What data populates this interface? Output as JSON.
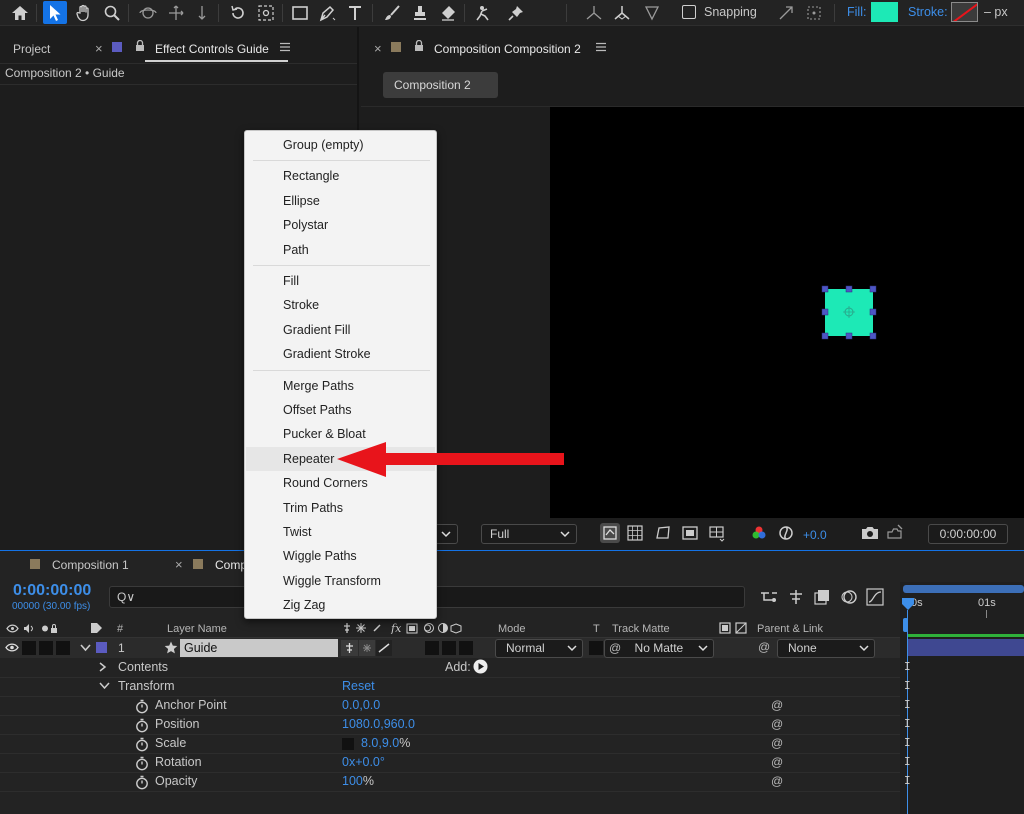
{
  "toolbar": {
    "snapping_label": "Snapping",
    "fill_label": "Fill:",
    "fill_color": "#1de9b6",
    "stroke_label": "Stroke:",
    "stroke_unit": "– px"
  },
  "left_panel": {
    "tab_project": "Project",
    "tab_effect_controls": "Effect Controls Guide",
    "subtitle": "Composition 2 • Guide"
  },
  "comp_panel": {
    "tab_title": "Composition Composition 2",
    "breadcrumb": "Composition 2",
    "shape_color": "#1de9b6"
  },
  "context_menu": {
    "groups": [
      [
        "Group (empty)"
      ],
      [
        "Rectangle",
        "Ellipse",
        "Polystar",
        "Path"
      ],
      [
        "Fill",
        "Stroke",
        "Gradient Fill",
        "Gradient Stroke"
      ],
      [
        "Merge Paths",
        "Offset Paths",
        "Pucker & Bloat",
        "Repeater",
        "Round Corners",
        "Trim Paths",
        "Twist",
        "Wiggle Paths",
        "Wiggle Transform",
        "Zig Zag"
      ]
    ],
    "highlighted": "Repeater",
    "arrow_color": "#e8141b"
  },
  "viewer_controls": {
    "resolution": "Full",
    "exposure": "+0.0",
    "timecode": "0:00:00:00"
  },
  "timeline": {
    "tab_comp1": "Composition 1",
    "tab_comp2_partial": "Comp",
    "current_time": "0:00:00:00",
    "frame_info": "00000 (30.00 fps)",
    "search_glyph": "Q∨",
    "columns": {
      "hash": "#",
      "layer_name": "Layer Name",
      "mode": "Mode",
      "t": "T",
      "track_matte": "Track Matte",
      "parent_link": "Parent & Link"
    },
    "ruler": [
      "0s",
      "01s"
    ],
    "layer": {
      "number": "1",
      "name": "Guide",
      "mode": "Normal",
      "matte": "No Matte",
      "parent": "None"
    },
    "contents_label": "Contents",
    "add_label": "Add:",
    "transform_label": "Transform",
    "reset_label": "Reset",
    "properties": [
      {
        "name": "Anchor Point",
        "value": "0.0,0.0"
      },
      {
        "name": "Position",
        "value": "1080.0,960.0"
      },
      {
        "name": "Scale",
        "value": "8.0,9.0",
        "suffix": "%"
      },
      {
        "name": "Rotation",
        "value": "0x+0.0°"
      },
      {
        "name": "Opacity",
        "value": "100",
        "suffix": "%"
      }
    ]
  }
}
